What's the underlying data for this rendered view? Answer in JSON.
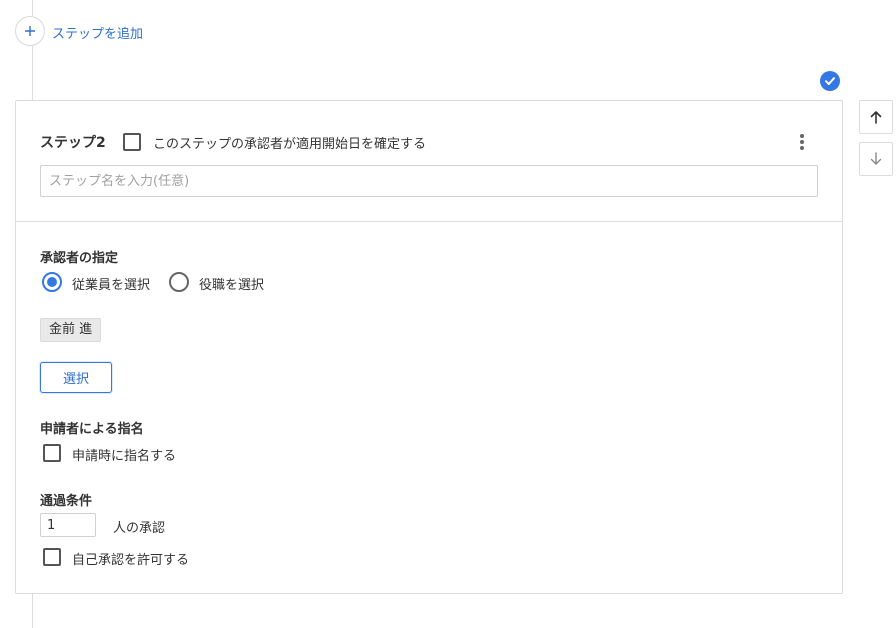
{
  "add_step": {
    "label": "ステップを追加",
    "icon": "plus-icon"
  },
  "status": {
    "icon": "check-circle-icon",
    "color": "#3478e3"
  },
  "step": {
    "title": "ステップ2",
    "confirm_start_date_label": "このステップの承認者が適用開始日を確定する",
    "confirm_start_date_checked": false,
    "name_placeholder": "ステップ名を入力(任意)",
    "name_value": "",
    "menu_icon": "more-vertical-icon"
  },
  "approver": {
    "section_title": "承認者の指定",
    "options": [
      {
        "label": "従業員を選択",
        "selected": true
      },
      {
        "label": "役職を選択",
        "selected": false
      }
    ],
    "selected_employee": "金前 進",
    "select_button_label": "選択"
  },
  "applicant_nomination": {
    "section_title": "申請者による指名",
    "checkbox_label": "申請時に指名する",
    "checked": false
  },
  "pass_condition": {
    "section_title": "通過条件",
    "count_value": "1",
    "count_suffix": "人の承認",
    "self_approval_label": "自己承認を許可する",
    "self_approval_checked": false
  },
  "reorder": {
    "up_icon": "arrow-up-icon",
    "down_icon": "arrow-down-icon"
  },
  "colors": {
    "accent": "#3478e3",
    "link": "#2f6fd0",
    "border": "#dcdcdc"
  }
}
